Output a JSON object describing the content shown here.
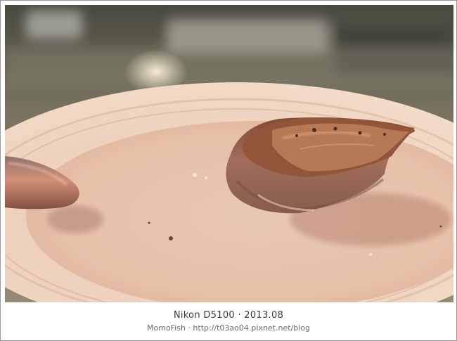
{
  "photo": {
    "subject": "food-photo",
    "colors": {
      "background_dark": "#3e4038",
      "plate": "#f1d9c6",
      "plate_rim": "#f7e6d8",
      "meat": "#8a5a48",
      "crust": "#6b3a24",
      "spoon": "#b0705a"
    }
  },
  "caption": {
    "title": "Nikon D5100 · 2013.08",
    "subtitle": "MomoFish · http://t03ao04.pixnet.net/blog"
  }
}
